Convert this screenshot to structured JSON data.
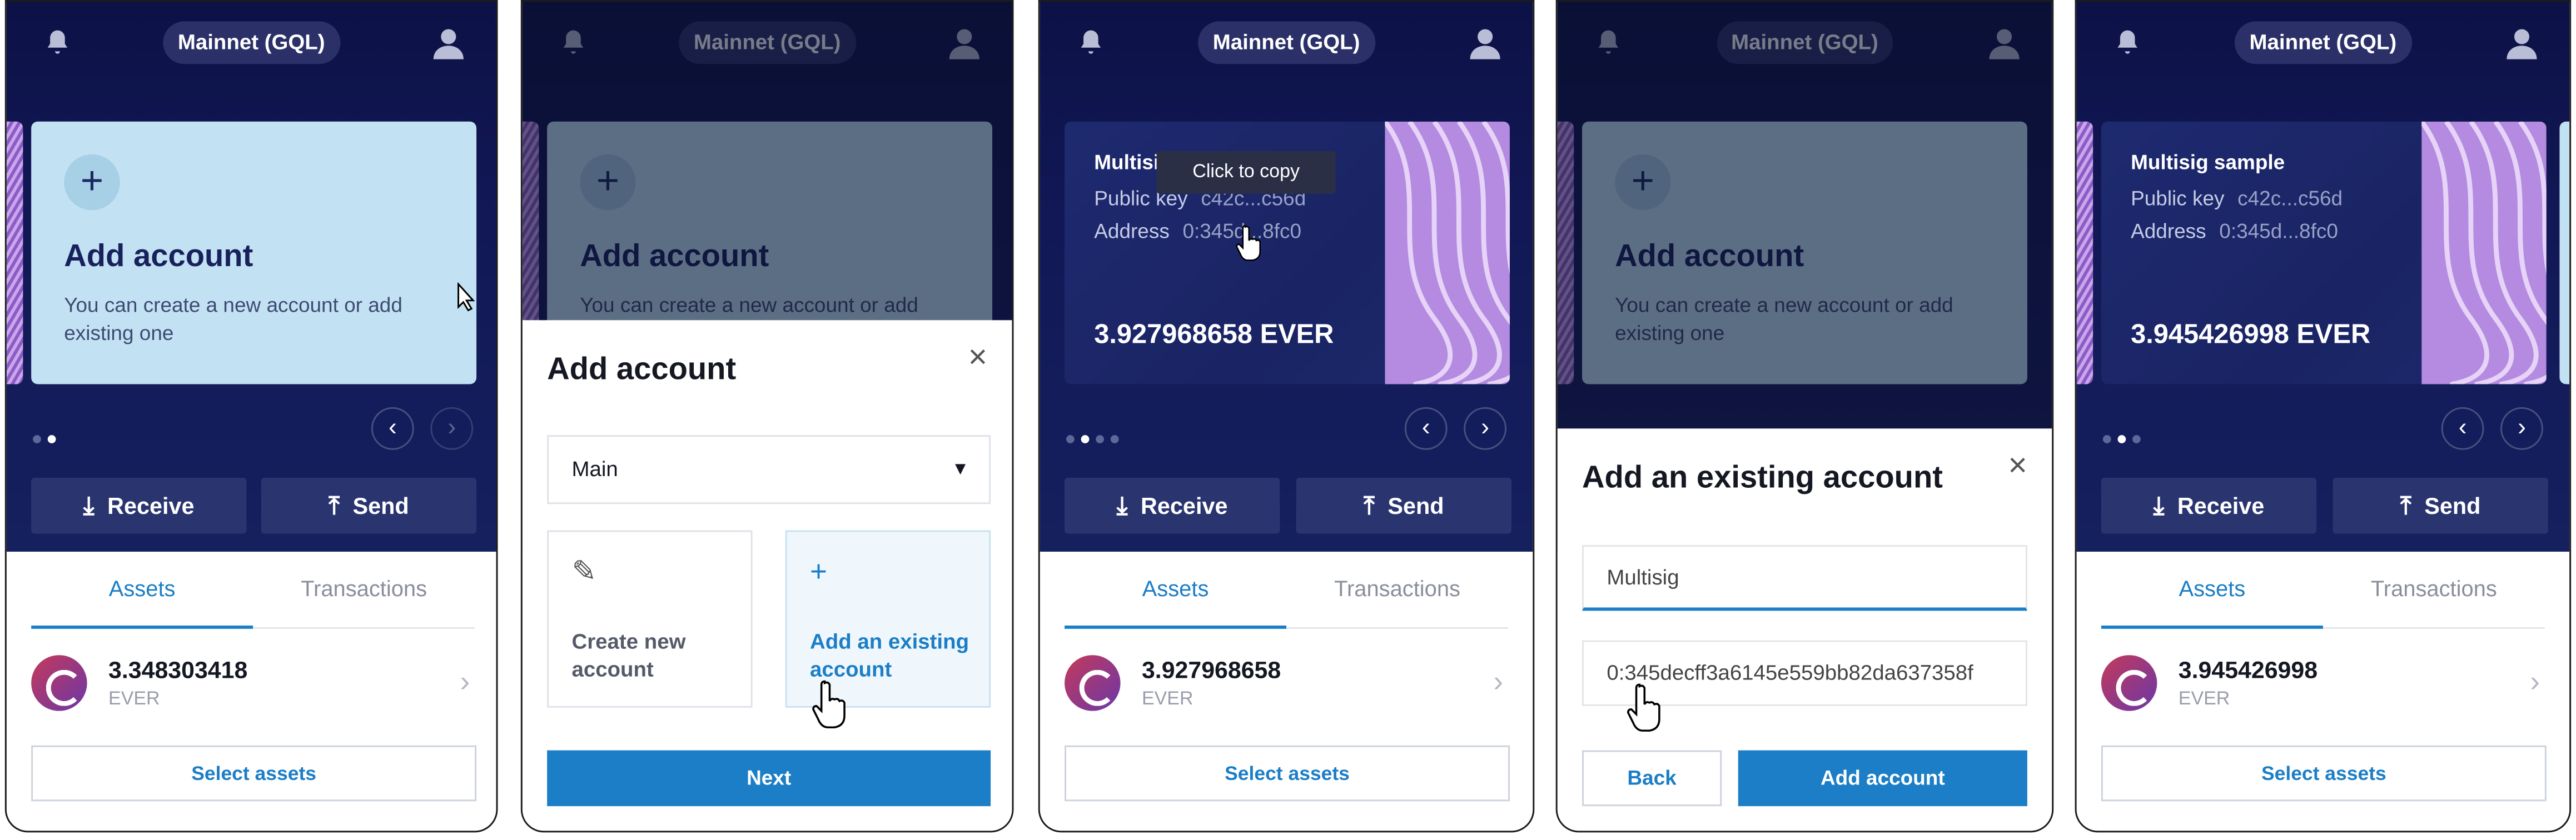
{
  "network": "Mainnet (GQL)",
  "add_card": {
    "title": "Add account",
    "desc": "You can create a new account or add existing one",
    "plus": "+"
  },
  "actions": {
    "receive": "Receive",
    "send": "Send",
    "receive_icon": "download-icon",
    "send_icon": "upload-icon"
  },
  "tabs": {
    "assets": "Assets",
    "transactions": "Transactions"
  },
  "select_assets": "Select assets",
  "currency": "EVER",
  "panel1": {
    "balance": "3.348303418"
  },
  "panel2": {
    "sheet_title": "Add account",
    "wallet_select": "Main",
    "option_create": "Create new account",
    "option_existing": "Add an existing account",
    "next": "Next"
  },
  "panel3": {
    "account_name": "Multisig sample",
    "public_key_label": "Public key",
    "public_key": "c42c...c56d",
    "address_label": "Address",
    "address": "0:345d...8fc0",
    "card_balance": "3.927968658 EVER",
    "tooltip": "Click to copy",
    "balance": "3.927968658"
  },
  "panel4": {
    "sheet_title": "Add an existing account",
    "name_value": "Multisig",
    "address_value": "0:345decff3a6145e559bb82da637358f",
    "back": "Back",
    "add": "Add account"
  },
  "panel5": {
    "account_name": "Multisig sample",
    "public_key_label": "Public key",
    "public_key": "c42c...c56d",
    "address_label": "Address",
    "address": "0:345d...8fc0",
    "card_balance": "3.945426998 EVER",
    "balance": "3.945426998"
  },
  "icons": {
    "close": "×",
    "chev_left": "‹",
    "chev_right": "›",
    "chev_asset": "›",
    "caret": "▼",
    "edit": "✎",
    "plus": "+"
  },
  "colors": {
    "accent": "#1b7ec6",
    "hero": "#121856",
    "add_card": "#c2e2f4"
  }
}
